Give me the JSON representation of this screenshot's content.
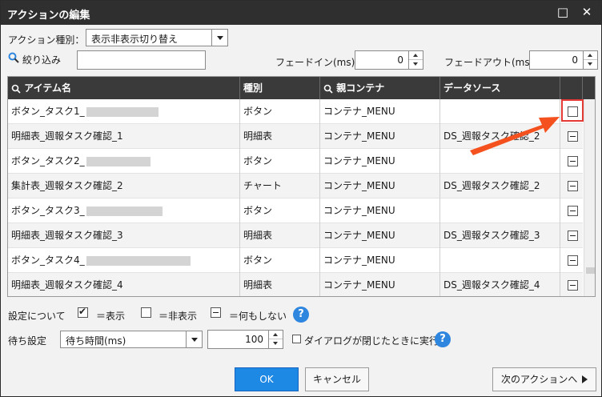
{
  "window": {
    "title": "アクションの編集",
    "restore_icon": "□",
    "close_icon": "✕"
  },
  "action_type": {
    "label": "アクション種別：",
    "value": "表示非表示切り替え"
  },
  "filter": {
    "label": "絞り込み",
    "value": ""
  },
  "fade_in": {
    "label": "フェードイン(ms)",
    "value": "0"
  },
  "fade_out": {
    "label": "フェードアウト(ms)",
    "value": "0"
  },
  "table": {
    "headers": [
      "アイテム名",
      "種別",
      "親コンテナ",
      "データソース"
    ],
    "rows": [
      {
        "name": "ボタン_タスク1_",
        "type": "ボタン",
        "parent": "コンテナ_MENU",
        "source": "",
        "state": "empty",
        "blurred": true
      },
      {
        "name": "明細表_週報タスク確認_1",
        "type": "明細表",
        "parent": "コンテナ_MENU",
        "source": "DS_週報タスク確認_2",
        "state": "dash",
        "blurred": false
      },
      {
        "name": "ボタン_タスク2_",
        "type": "ボタン",
        "parent": "コンテナ_MENU",
        "source": "",
        "state": "dash",
        "blurred": true
      },
      {
        "name": "集計表_週報タスク確認_2",
        "type": "チャート",
        "parent": "コンテナ_MENU",
        "source": "DS_週報タスク確認_2",
        "state": "dash",
        "blurred": false
      },
      {
        "name": "ボタン_タスク3_",
        "type": "ボタン",
        "parent": "コンテナ_MENU",
        "source": "",
        "state": "dash",
        "blurred": true
      },
      {
        "name": "明細表_週報タスク確認_3",
        "type": "明細表",
        "parent": "コンテナ_MENU",
        "source": "DS_週報タスク確認_3",
        "state": "dash",
        "blurred": false
      },
      {
        "name": "ボタン_タスク4_",
        "type": "ボタン",
        "parent": "コンテナ_MENU",
        "source": "",
        "state": "dash",
        "blurred": true
      },
      {
        "name": "明細表_週報タスク確認_4",
        "type": "明細表",
        "parent": "コンテナ_MENU",
        "source": "DS_週報タスク確認_4",
        "state": "dash",
        "blurred": false
      }
    ]
  },
  "legend": {
    "label": "設定について",
    "show": "＝表示",
    "hide": "＝非表示",
    "none": "＝何もしない"
  },
  "wait": {
    "label": "待ち設定",
    "mode": "待ち時間(ms)",
    "value": "100",
    "dialog_label": "ダイアログが閉じたときに実行"
  },
  "buttons": {
    "ok": "OK",
    "cancel": "キャンセル",
    "next": "次のアクションへ"
  },
  "colors": {
    "accent": "#1e88e5",
    "header": "#3a3a3a",
    "annotation": "#e53935"
  }
}
